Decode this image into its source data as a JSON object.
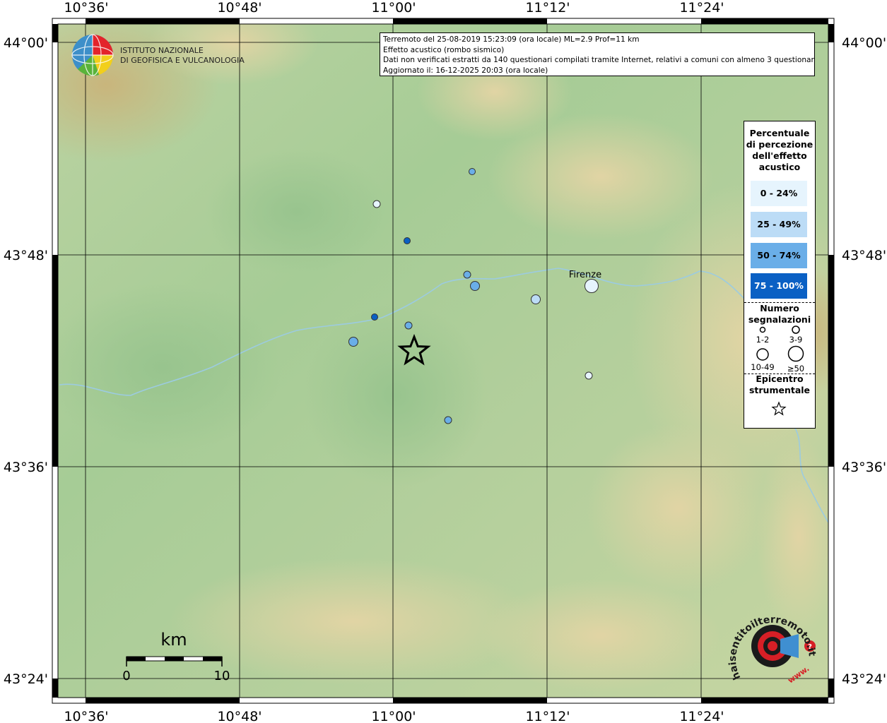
{
  "map": {
    "lon_labels_top": [
      "10°36'",
      "10°48'",
      "11°00'",
      "11°12'",
      "11°24'"
    ],
    "lon_labels_bottom": [
      "10°36'",
      "10°48'",
      "11°00'",
      "11°12'",
      "11°24'"
    ],
    "lat_labels_left": [
      "44°00'",
      "43°48'",
      "43°36'",
      "43°24'"
    ],
    "lat_labels_right": [
      "44°00'",
      "43°48'",
      "43°36'",
      "43°24'"
    ],
    "city_label": "Firenze",
    "scalebar": {
      "unit": "km",
      "start": "0",
      "end": "10"
    }
  },
  "institute": {
    "line1": "ISTITUTO NAZIONALE",
    "line2": "DI GEOFISICA E VULCANOLOGIA"
  },
  "info": {
    "line1": "Terremoto del 25-08-2019 15:23:09 (ora locale) ML=2.9 Prof=11 km",
    "line2": "Effetto acustico (rombo sismico)",
    "line3": "Dati non verificati estratti da 140 questionari compilati tramite Internet, relativi a comuni con almeno 3 questionari.",
    "line4": "Aggiornato il: 16-12-2025 20:03 (ora locale)"
  },
  "legend": {
    "title1": "Percentuale",
    "title2": "di percezione",
    "title3": "dell'effetto",
    "title4": "acustico",
    "classes": [
      {
        "label": "0 - 24%",
        "color": "#e6f4fd"
      },
      {
        "label": "25 - 49%",
        "color": "#bcdcf6"
      },
      {
        "label": "50 - 74%",
        "color": "#6aaee8"
      },
      {
        "label": "75 - 100%",
        "color": "#0a60c4"
      }
    ],
    "count_title1": "Numero",
    "count_title2": "segnalazioni",
    "sizes": [
      "1-2",
      "3-9",
      "10-49",
      "≥50"
    ],
    "epi_title1": "Epicentro",
    "epi_title2": "strumentale"
  },
  "logo": {
    "text": "haisentitoilterremoto.it",
    "www": "www."
  },
  "colors": {
    "class_0": "#e6f4fd",
    "class_1": "#bcdcf6",
    "class_2": "#6aaee8",
    "class_3": "#0a60c4",
    "river": "#9ccbe0"
  }
}
